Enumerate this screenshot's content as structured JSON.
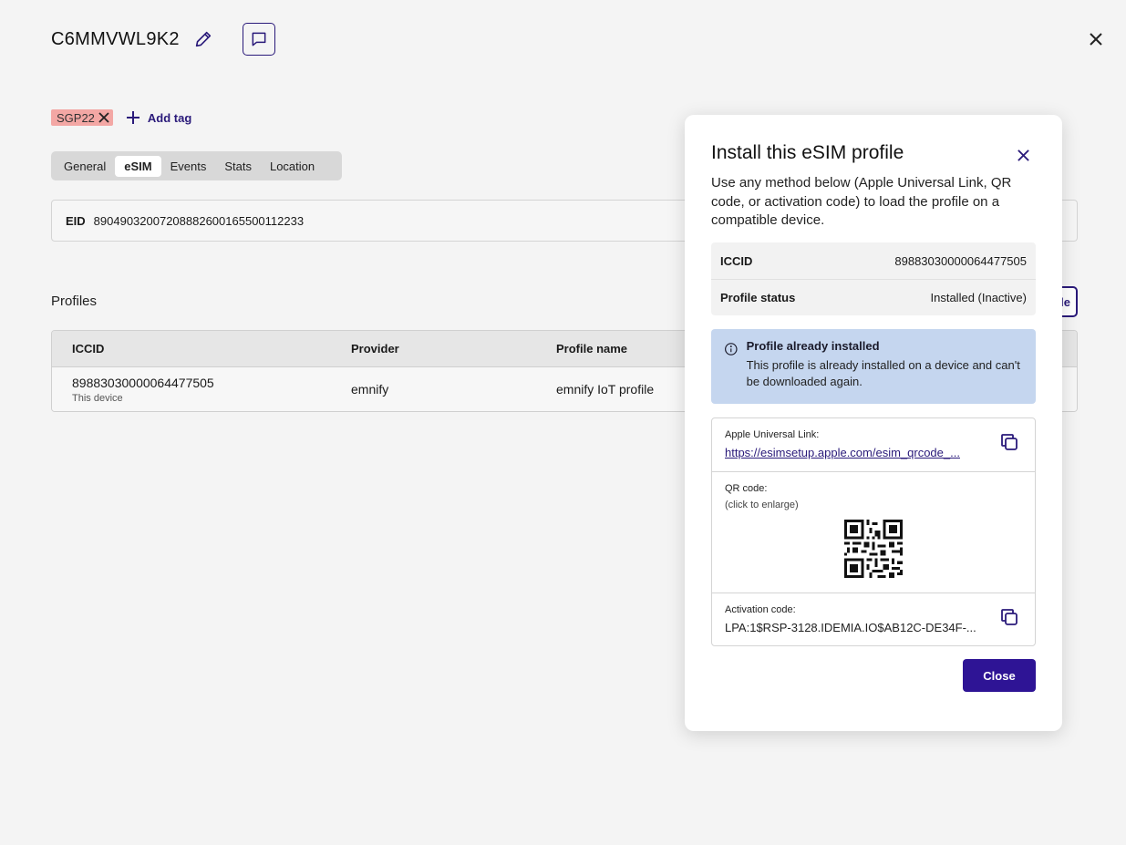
{
  "page": {
    "title": "C6MMVWL9K2"
  },
  "tags": {
    "items": [
      "SGP22"
    ],
    "add_label": "Add tag"
  },
  "tabs": [
    "General",
    "eSIM",
    "Events",
    "Stats",
    "Location"
  ],
  "active_tab": "eSIM",
  "eid": {
    "label": "EID",
    "value": "89049032007208882600165500112233"
  },
  "profiles": {
    "title": "Profiles",
    "add_button_label": "le",
    "columns": [
      "ICCID",
      "Provider",
      "Profile name"
    ],
    "rows": [
      {
        "iccid": "89883030000064477505",
        "iccid_note": "This device",
        "provider": "emnify",
        "profile_name": "emnify IoT profile"
      }
    ]
  },
  "modal": {
    "title": "Install this eSIM profile",
    "description": "Use any method below (Apple Universal Link, QR code, or activation code) to load the profile on a compatible device.",
    "info": [
      {
        "label": "ICCID",
        "value": "89883030000064477505"
      },
      {
        "label": "Profile status",
        "value": "Installed (Inactive)"
      }
    ],
    "alert": {
      "title": "Profile already installed",
      "text": "This profile is already installed on a device and can't be downloaded again.",
      "color": "#c5d6ef"
    },
    "apple_link": {
      "label": "Apple Universal Link:",
      "value": "https://esimsetup.apple.com/esim_qrcode_..."
    },
    "qr": {
      "label": "QR code:",
      "hint": "(click to enlarge)"
    },
    "activation": {
      "label": "Activation code:",
      "value": "LPA:1$RSP-3128.IDEMIA.IO$AB12C-DE34F-..."
    },
    "close_label": "Close"
  },
  "colors": {
    "accent": "#2e1495",
    "tag": "#f3a7a4"
  }
}
